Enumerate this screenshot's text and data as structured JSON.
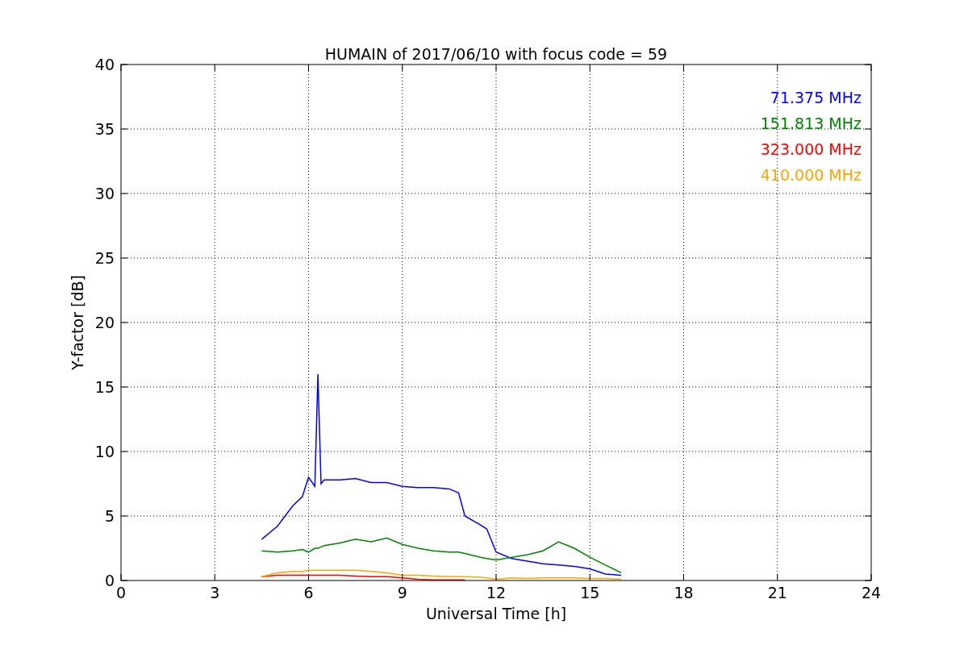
{
  "figure": {
    "chart_data": {
      "type": "line",
      "title": "HUMAIN of 2017/06/10 with focus code = 59",
      "xlabel": "Universal Time [h]",
      "ylabel": "Y-factor [dB]",
      "x": [
        4.5,
        5,
        5.5,
        5.8,
        6,
        6.2,
        6.3,
        6.4,
        6.5,
        7,
        7.5,
        8,
        8.5,
        9,
        9.5,
        10,
        10.5,
        10.8,
        11,
        11.5,
        11.7,
        12,
        12.5,
        13,
        13.5,
        14,
        14.5,
        15,
        15.5,
        16
      ],
      "series": [
        {
          "name": "71.375 MHz",
          "color": "#0000ff",
          "values": [
            3.2,
            4.2,
            5.8,
            6.5,
            8,
            7.3,
            16,
            7.5,
            7.8,
            7.8,
            7.9,
            7.6,
            7.6,
            7.3,
            7.2,
            7.2,
            7.1,
            6.8,
            5,
            4.3,
            4,
            2.2,
            1.7,
            1.5,
            1.3,
            1.2,
            1.1,
            0.9,
            0.5,
            0.4
          ]
        },
        {
          "name": "151.813 MHz",
          "color": "#008000",
          "values": [
            2.3,
            2.2,
            2.3,
            2.4,
            2.2,
            2.5,
            2.5,
            2.6,
            2.7,
            2.9,
            3.2,
            3.0,
            3.3,
            2.8,
            2.5,
            2.3,
            2.2,
            2.2,
            2.1,
            1.8,
            1.7,
            1.6,
            1.8,
            2.0,
            2.3,
            3.0,
            2.5,
            1.8,
            1.2,
            0.6
          ]
        },
        {
          "name": "323.000 MHz",
          "color": "#ff0000",
          "values": [
            0.3,
            0.4,
            0.4,
            0.4,
            0.4,
            0.4,
            0.4,
            0.4,
            0.4,
            0.4,
            0.35,
            0.3,
            0.3,
            0.2,
            0.1,
            0.05,
            0.05,
            0.05,
            0.05,
            null,
            null,
            null,
            null,
            null,
            null,
            null,
            null,
            null,
            null,
            null
          ]
        },
        {
          "name": "410.000 MHz",
          "color": "#ffa500",
          "values": [
            0.3,
            0.6,
            0.7,
            0.7,
            0.8,
            0.8,
            0.8,
            0.8,
            0.8,
            0.8,
            0.8,
            0.7,
            0.6,
            0.4,
            0.4,
            0.35,
            0.3,
            0.3,
            0.3,
            0.25,
            0.2,
            0.1,
            0.2,
            0.15,
            0.2,
            0.2,
            0.2,
            0.15,
            0.15,
            0.1
          ]
        }
      ],
      "grid": true,
      "xlim": [
        0,
        24
      ],
      "ylim": [
        0,
        40
      ],
      "xticks": [
        0,
        3,
        6,
        9,
        12,
        15,
        18,
        21,
        24
      ],
      "yticks": [
        0,
        5,
        10,
        15,
        20,
        25,
        30,
        35,
        40
      ]
    }
  }
}
